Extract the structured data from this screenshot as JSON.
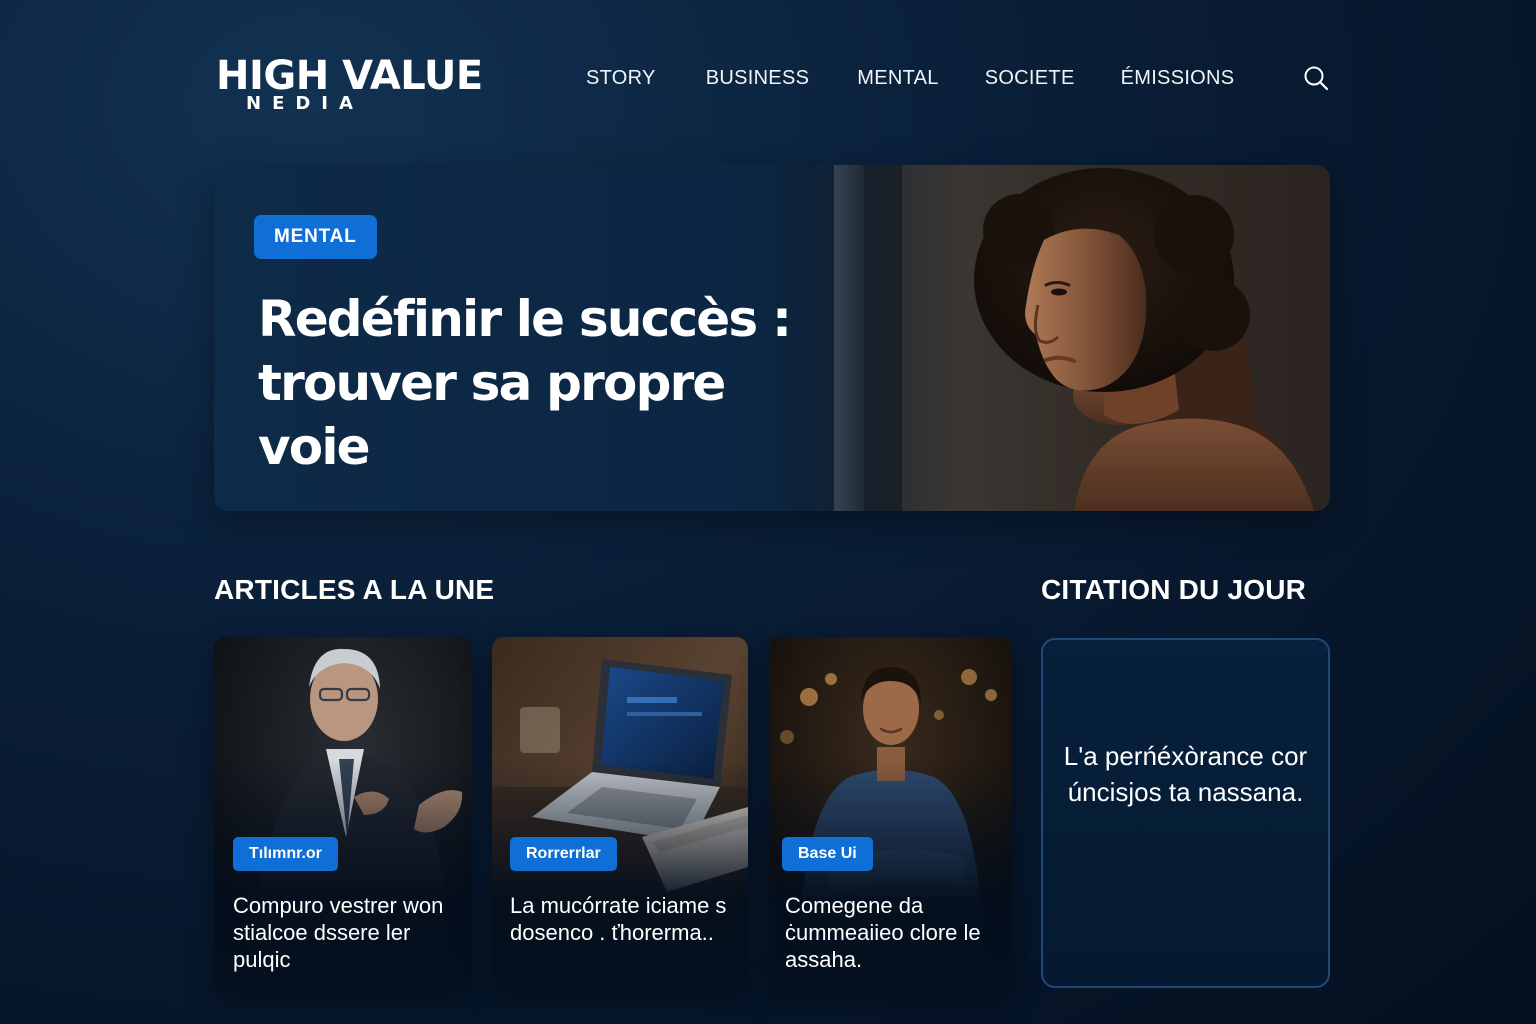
{
  "header": {
    "logo_main": "HIGH VALUE",
    "logo_sub": "NEDIA",
    "nav": [
      "STORY",
      "BUSINESS",
      "MENTAL",
      "SOCIETE",
      "ÉMISSIONS"
    ],
    "search_icon": "search-icon"
  },
  "hero": {
    "badge": "MENTAL",
    "title": "Redéfinir le succès : trouver sa propre voie",
    "image": "woman-portrait-photo"
  },
  "sections": {
    "articles_title": "ARTICLES A LA UNE",
    "quote_title": "CITATION DU JOUR"
  },
  "articles": [
    {
      "badge": "Tılımnr.or",
      "title": "Compuro vestrer won stialcoe dssere ler pulqic",
      "image": "speaker-photo"
    },
    {
      "badge": "Rorrerrlar",
      "title": "La mucórrate iciame s dosenco . ťhorerma..",
      "image": "laptop-photo"
    },
    {
      "badge": "Base Ui",
      "title": "Comegene da ċummeaiieo clore le assaha.",
      "image": "man-portrait-photo"
    }
  ],
  "quote": {
    "text": "L'a perńéxòrance cor úncisjos ta nassana."
  },
  "colors": {
    "accent": "#0f6fd6",
    "background": "#0a1f38",
    "quote_border": "#1d4a7a"
  }
}
